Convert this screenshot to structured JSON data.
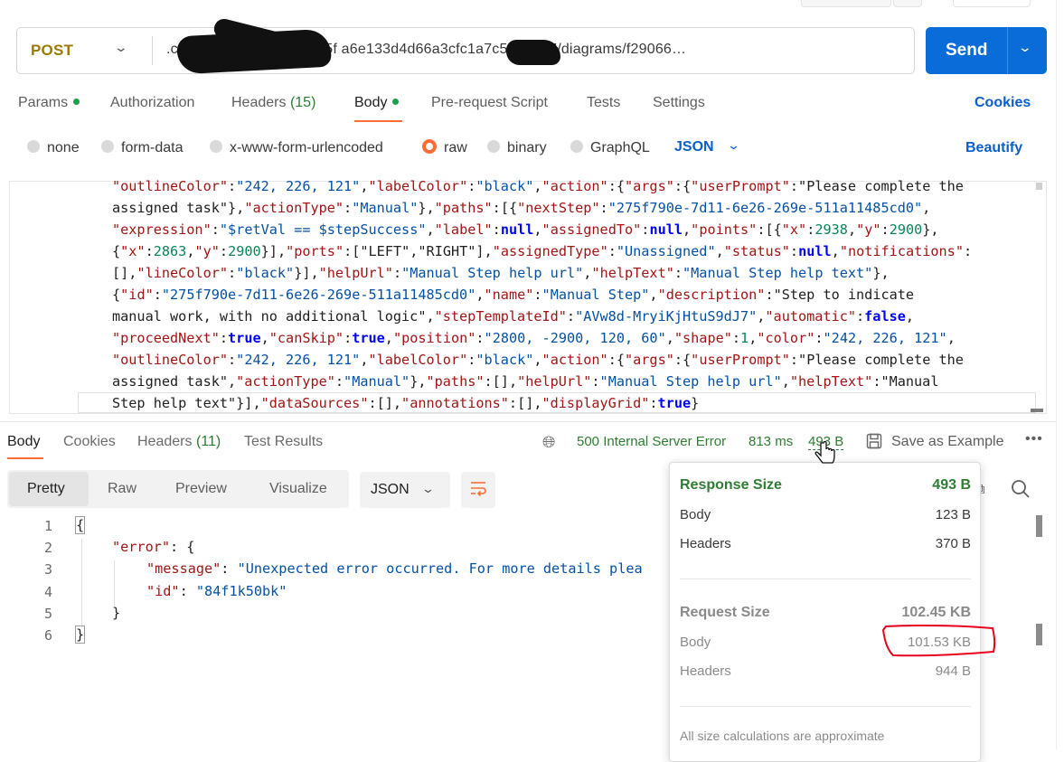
{
  "request": {
    "method": "POST",
    "url": ".co/serverwfm/workflow/5f         a6e133d4d66a3cfc1a7c535d6d7/diagrams/f29066…",
    "send_label": "Send"
  },
  "request_tabs": {
    "params": "Params",
    "authorization": "Authorization",
    "headers": "Headers",
    "headers_count": "(15)",
    "body": "Body",
    "prerequest": "Pre-request Script",
    "tests": "Tests",
    "settings": "Settings",
    "cookies": "Cookies"
  },
  "body_types": {
    "none": "none",
    "form_data": "form-data",
    "urlencoded": "x-www-form-urlencoded",
    "raw": "raw",
    "binary": "binary",
    "graphql": "GraphQL",
    "selected_format": "JSON",
    "beautify": "Beautify"
  },
  "request_body_lines": [
    "\"outlineColor\":\"242, 226, 121\",\"labelColor\":\"black\",\"action\":{\"args\":{\"userPrompt\":\"Please complete the",
    "assigned task\"},\"actionType\":\"Manual\"},\"paths\":[{\"nextStep\":\"275f790e-7d11-6e26-269e-511a11485cd0\",",
    "\"expression\":\"$retVal == $stepSuccess\",\"label\":null,\"assignedTo\":null,\"points\":[{\"x\":2938,\"y\":2900},",
    "{\"x\":2863,\"y\":2900}],\"ports\":[\"LEFT\",\"RIGHT\"],\"assignedType\":\"Unassigned\",\"status\":null,\"notifications\":",
    "[],\"lineColor\":\"black\"}],\"helpUrl\":\"Manual Step help url\",\"helpText\":\"Manual Step help text\"},",
    "{\"id\":\"275f790e-7d11-6e26-269e-511a11485cd0\",\"name\":\"Manual Step\",\"description\":\"Step to indicate",
    "manual work, with no additional logic\",\"stepTemplateId\":\"AVw8d-MryiKjHtuS9dJ7\",\"automatic\":false,",
    "\"proceedNext\":true,\"canSkip\":true,\"position\":\"2800, -2900, 120, 60\",\"shape\":1,\"color\":\"242, 226, 121\",",
    "\"outlineColor\":\"242, 226, 121\",\"labelColor\":\"black\",\"action\":{\"args\":{\"userPrompt\":\"Please complete the",
    "assigned task\",\"actionType\":\"Manual\"},\"paths\":[],\"helpUrl\":\"Manual Step help url\",\"helpText\":\"Manual",
    "Step help text\"}],\"dataSources\":[],\"annotations\":[],\"displayGrid\":true}"
  ],
  "response_tabs": {
    "body": "Body",
    "cookies": "Cookies",
    "headers": "Headers",
    "headers_count": "(11)",
    "test_results": "Test Results"
  },
  "response_meta": {
    "status": "500 Internal Server Error",
    "time": "813 ms",
    "size": "493 B",
    "save_example": "Save as Example",
    "more": "•••"
  },
  "view_modes": {
    "pretty": "Pretty",
    "raw": "Raw",
    "preview": "Preview",
    "visualize": "Visualize",
    "format": "JSON"
  },
  "response_lines": {
    "numbers": [
      "1",
      "2",
      "3",
      "4",
      "5",
      "6"
    ],
    "l1": "{",
    "l2_key": "\"error\"",
    "l2_rest": ": {",
    "l3_key": "\"message\"",
    "l3_sep": ": ",
    "l3_val": "\"Unexpected error occurred. For more details plea",
    "l4_key": "\"id\"",
    "l4_sep": ": ",
    "l4_val": "\"84f1k50bk\"",
    "l5": "}",
    "l6": "}"
  },
  "size_popover": {
    "response_size_label": "Response Size",
    "response_size": "493 B",
    "body_label": "Body",
    "body": "123 B",
    "headers_label": "Headers",
    "headers": "370 B",
    "request_size_label": "Request Size",
    "request_size": "102.45 KB",
    "req_body_label": "Body",
    "req_body": "101.53 KB",
    "req_headers_label": "Headers",
    "req_headers": "944 B",
    "note": "All size calculations are approximate"
  },
  "colors": {
    "accent": "#ff6c37",
    "primary": "#0a6cd9",
    "success": "#2e7d32",
    "method": "#9a7b00",
    "annotation": "#e8001c"
  },
  "icons": [
    "chevron-down-icon",
    "globe-icon",
    "save-icon",
    "more-icon",
    "wrap-icon",
    "copy-icon",
    "search-icon",
    "mouse-pointer-icon"
  ]
}
